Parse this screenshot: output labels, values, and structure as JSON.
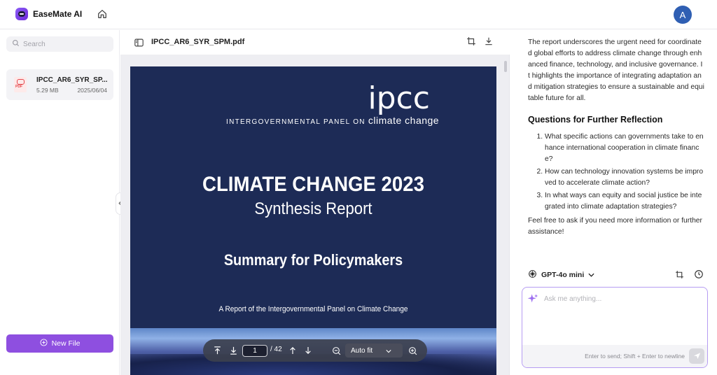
{
  "app": {
    "name": "EaseMate AI",
    "avatar_letter": "A",
    "brand_color": "#8e4fe0"
  },
  "sidebar": {
    "search_placeholder": "Search",
    "files": [
      {
        "name": "IPCC_AR6_SYR_SP...",
        "size": "5.29 MB",
        "date": "2025/06/04",
        "icon": "pdf-file-icon"
      }
    ],
    "new_file_label": "New File"
  },
  "viewer": {
    "doc_title": "IPCC_AR6_SYR_SPM.pdf",
    "page": {
      "logo": "ipcc",
      "org_prefix": "INTERGOVERNMENTAL PANEL ON",
      "org_suffix": "climate change",
      "title": "CLIMATE CHANGE 2023",
      "subtitle": "Synthesis Report",
      "section": "Summary for Policymakers",
      "byline": "A Report of the Intergovernmental Panel on Climate Change"
    },
    "toolbar": {
      "current_page": "1",
      "total_pages": "/ 42",
      "zoom": "Auto fit"
    }
  },
  "chat": {
    "paragraph": "The report underscores the urgent need for coordinated global efforts to address climate change through enhanced finance, technology, and inclusive governance. It highlights the importance of integrating adaptation and mitigation strategies to ensure a sustainable and equitable future for all.",
    "questions_heading": "Questions for Further Reflection",
    "questions": [
      "What specific actions can governments take to enhance international cooperation in climate finance?",
      "How can technology innovation systems be improved to accelerate climate action?",
      "In what ways can equity and social justice be integrated into climate adaptation strategies?"
    ],
    "closing": "Feel free to ask if you need more information or further assistance!",
    "model": "GPT-4o mini",
    "input_placeholder": "Ask me anything...",
    "hint": "Enter to send; Shift + Enter to newline"
  }
}
